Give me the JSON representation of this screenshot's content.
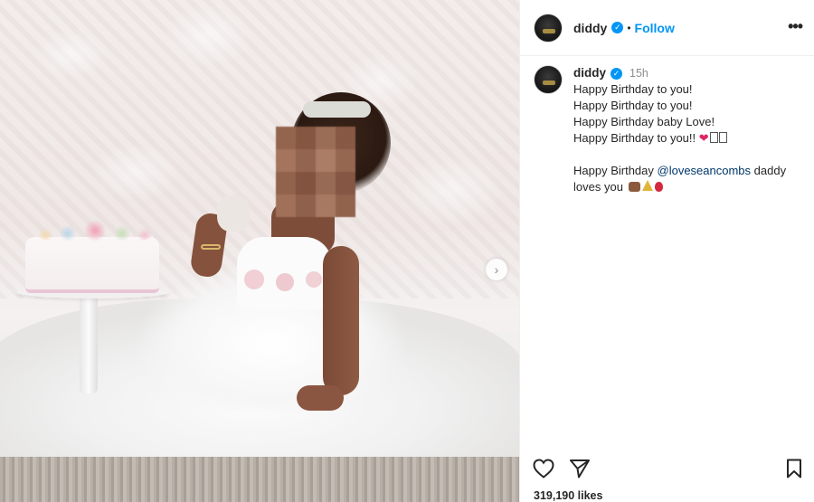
{
  "post": {
    "author": "diddy",
    "follow_label": "Follow",
    "separator": "•",
    "more_label": "•••",
    "verified_glyph": "✓"
  },
  "caption": {
    "author": "diddy",
    "time": "15h",
    "lines": [
      "Happy Birthday to you!",
      "Happy Birthday to you!",
      "Happy Birthday baby Love!",
      "Happy Birthday to you!!"
    ],
    "line5_prefix": "Happy Birthday ",
    "mention": "@loveseancombs",
    "line5_suffix": " daddy",
    "line6": "loves you"
  },
  "stats": {
    "likes": "319,190 likes"
  },
  "icons": {
    "heart": "heart-icon",
    "share": "share-icon",
    "bookmark": "bookmark-icon",
    "more": "more-options-icon",
    "next": "chevron-right-icon"
  },
  "colors": {
    "accent": "#0095f6",
    "text": "#262626",
    "muted": "#8e8e8e",
    "mention": "#00376b"
  }
}
